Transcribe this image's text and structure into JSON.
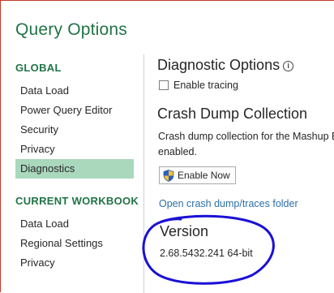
{
  "dialog": {
    "title": "Query Options"
  },
  "sidebar": {
    "global_heading": "GLOBAL",
    "global_items": [
      {
        "label": "Data Load"
      },
      {
        "label": "Power Query Editor"
      },
      {
        "label": "Security"
      },
      {
        "label": "Privacy"
      },
      {
        "label": "Diagnostics",
        "selected": true
      }
    ],
    "workbook_heading": "CURRENT WORKBOOK",
    "workbook_items": [
      {
        "label": "Data Load"
      },
      {
        "label": "Regional Settings"
      },
      {
        "label": "Privacy"
      }
    ]
  },
  "main": {
    "diagnostic_heading": "Diagnostic Options",
    "info_icon_glyph": "i",
    "enable_tracing_label": "Enable tracing",
    "enable_tracing_checked": false,
    "crash_heading": "Crash Dump Collection",
    "crash_description_line1": "Crash dump collection for the Mashup En",
    "crash_description_line2": "enabled.",
    "enable_now_label": "Enable Now",
    "open_folder_link": "Open crash dump/traces folder",
    "version_heading": "Version",
    "version_value": "2.68.5432.241 64-bit"
  },
  "colors": {
    "accent_green": "#217346",
    "selected_bg": "#a9d8bd",
    "link_blue": "#2e6ea6",
    "annotation_blue": "#1a10d6"
  },
  "icons": {
    "shield": "uac-shield-icon"
  }
}
